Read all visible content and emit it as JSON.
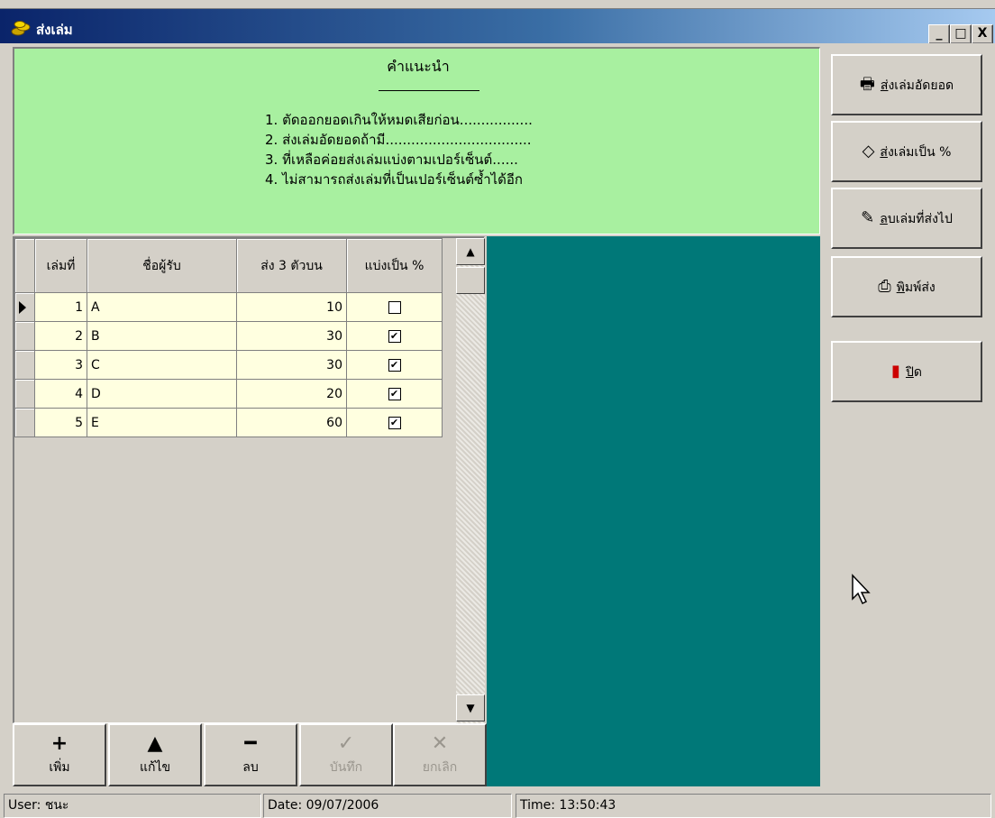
{
  "window": {
    "title": "ส่งเล่ม",
    "minimize_label": "_",
    "maximize_label": "□",
    "close_label": "X"
  },
  "instructions": {
    "title": "คำแนะนำ",
    "items": [
      "1. ตัดออกยอดเกินให้หมดเสียก่อน.................",
      "2. ส่งเล่มอัดยอดถ้ามี..................................",
      "3. ที่เหลือค่อยส่งเล่มแบ่งตามเปอร์เซ็นต์......",
      "4. ไม่สามารถส่งเล่มที่เป็นเปอร์เซ็นต์ซ้ำได้อีก"
    ]
  },
  "grid": {
    "columns": [
      "เล่มที่",
      "ชื่อผู้รับ",
      "ส่ง 3 ตัวบน",
      "แบ่งเป็น %"
    ],
    "rows": [
      {
        "no": "1",
        "name": "A",
        "amount": "10",
        "percent": false
      },
      {
        "no": "2",
        "name": "B",
        "amount": "30",
        "percent": true
      },
      {
        "no": "3",
        "name": "C",
        "amount": "30",
        "percent": true
      },
      {
        "no": "4",
        "name": "D",
        "amount": "20",
        "percent": true
      },
      {
        "no": "5",
        "name": "E",
        "amount": "60",
        "percent": true
      }
    ],
    "current_row": 1
  },
  "navigator": {
    "add": "เพิ่ม",
    "edit": "แก้ไข",
    "delete": "ลบ",
    "save": "บันทึก",
    "cancel": "ยกเลิก",
    "icons": {
      "add": "+",
      "edit": "▲",
      "delete": "━",
      "save": "✓",
      "cancel": "✕"
    }
  },
  "side_buttons": {
    "fixed": {
      "shortcut": "ส",
      "label": "่งเล่มอัดยอด",
      "icon": "printer-icon"
    },
    "percent": {
      "shortcut": "ส",
      "label": "่งเล่มเป็น %",
      "icon": "book-icon"
    },
    "remove": {
      "shortcut": "ล",
      "label": "บเล่มที่ส่งไป",
      "icon": "eraser-icon"
    },
    "print": {
      "shortcut": "พ",
      "label": "ิมพ์ส่ง",
      "icon": "print-icon"
    },
    "close": {
      "shortcut": "ป",
      "label": "ิด",
      "icon": "door-icon"
    }
  },
  "status": {
    "user": "User: ชนะ",
    "date": "Date: 09/07/2006",
    "time": "Time: 13:50:43"
  },
  "colors": {
    "instructions_bg": "#a8f0a0",
    "grid_cell_bg": "#ffffe0",
    "teal_panel": "#007878",
    "title_gradient_start": "#0a246a"
  }
}
